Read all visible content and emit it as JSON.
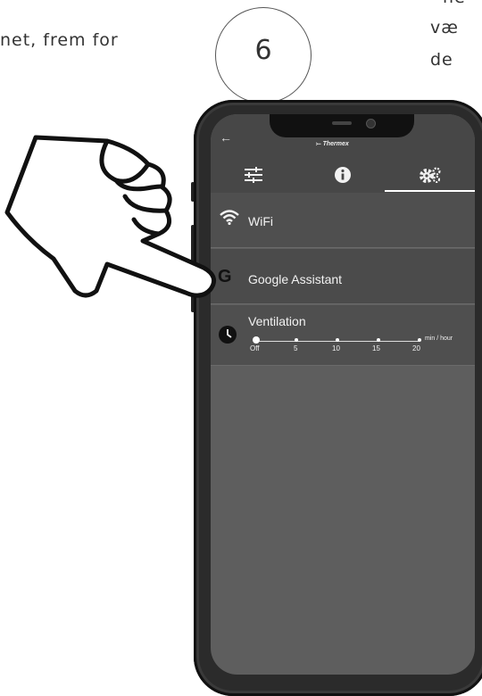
{
  "document": {
    "left_text": "net, frem for",
    "right_lines": [
      "ne",
      "væ",
      "de"
    ],
    "step_number": "6"
  },
  "app": {
    "brand": "Thermex",
    "tabs": [
      {
        "name": "controls",
        "icon": "sliders-icon"
      },
      {
        "name": "info",
        "icon": "info-icon"
      },
      {
        "name": "settings",
        "icon": "gears-icon",
        "active": true
      }
    ],
    "settings": {
      "wifi_label": "WiFi",
      "google_label": "Google Assistant",
      "ventilation": {
        "label": "Ventilation",
        "ticks": [
          "Off",
          "5",
          "10",
          "15",
          "20"
        ],
        "unit": "min / hour",
        "value": "Off"
      }
    }
  },
  "colors": {
    "screen_bg": "#5e5e5e",
    "header_bg": "#474747",
    "row_bg": "#4f4f4f",
    "text": "#f2f2f2"
  }
}
